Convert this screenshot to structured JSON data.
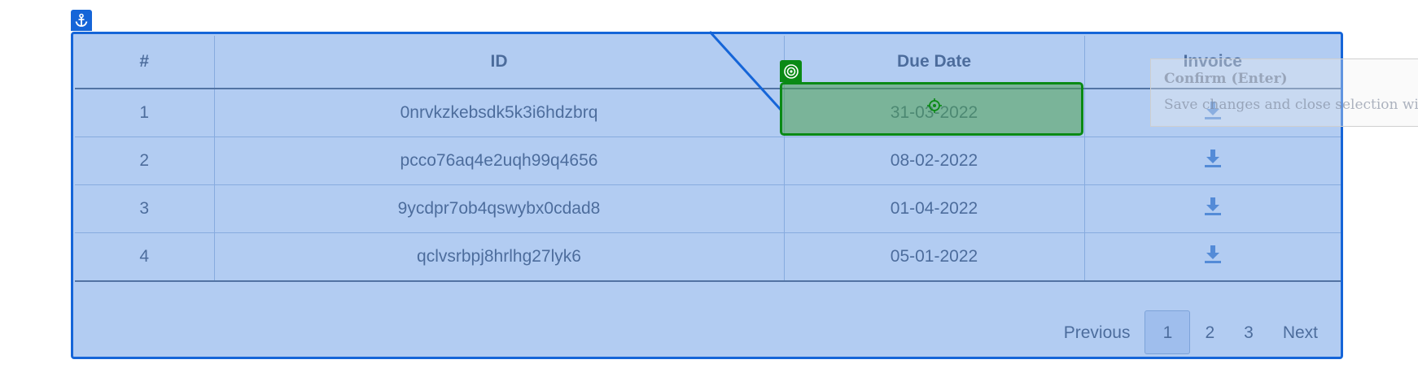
{
  "table": {
    "headers": [
      "#",
      "ID",
      "Due Date",
      "Invoice"
    ],
    "rows": [
      {
        "num": "1",
        "id": "0nrvkzkebsdk5k3i6hdzbrq",
        "due": "31-03-2022",
        "invoice_icon": "download-icon"
      },
      {
        "num": "2",
        "id": "pcco76aq4e2uqh99q4656",
        "due": "08-02-2022",
        "invoice_icon": "download-icon"
      },
      {
        "num": "3",
        "id": "9ycdpr7ob4qswybx0cdad8",
        "due": "01-04-2022",
        "invoice_icon": "download-icon"
      },
      {
        "num": "4",
        "id": "qclvsrbpj8hrlhg27lyk6",
        "due": "05-01-2022",
        "invoice_icon": "download-icon"
      }
    ]
  },
  "pagination": {
    "previous": "Previous",
    "pages": [
      "1",
      "2",
      "3"
    ],
    "active_page": "1",
    "next": "Next"
  },
  "tooltip": {
    "title": "Confirm (Enter)",
    "description": "Save changes and close selection wizard"
  },
  "icons": {
    "anchor": "anchor-icon",
    "target": "target-icon",
    "download": "download-icon"
  },
  "colors": {
    "selection_blue": "#1565d8",
    "target_green": "#0a8a15",
    "overlay": "#73a3e8"
  }
}
